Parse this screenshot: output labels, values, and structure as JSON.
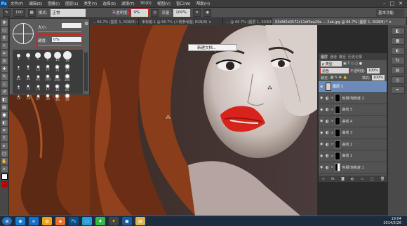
{
  "menu": {
    "app_icon": "Ps",
    "items": [
      "文件(F)",
      "编辑(E)",
      "图像(I)",
      "图层(L)",
      "类型(Y)",
      "选择(S)",
      "滤镜(T)",
      "3D(D)",
      "视图(V)",
      "窗口(W)",
      "帮助(H)"
    ],
    "window_controls": [
      "–",
      "□",
      "✕"
    ]
  },
  "options": {
    "brush_size": "100",
    "mode_label": "模式:",
    "mode_value": "正常",
    "opacity_label": "不透明度:",
    "opacity_value": "9%",
    "flow_label": "流量:",
    "flow_value": "100%",
    "workspace": "基本功能"
  },
  "tabs": [
    {
      "label": "... 66.7% (图层 1, RGB/8) ×",
      "active": false
    },
    {
      "label": "未标题-1 @ 66.7% (人物参考图, RGB/8) ×",
      "active": false
    },
    {
      "label": "... @ 66.7% (图层 1, RGB/8) ×",
      "active": false
    },
    {
      "label": "93d9f2d3572c11df3ea29e ... 2ab.jpg @ 66.7% (图层 1, RGB/8) * ×",
      "active": true
    }
  ],
  "brush_panel": {
    "size_label": "大小:",
    "hardness_label": "硬度:",
    "hardness_value": "0%",
    "presets": [
      {
        "size": "1"
      },
      {
        "size": "3"
      },
      {
        "size": "5"
      },
      {
        "size": "9"
      },
      {
        "size": "13"
      },
      {
        "size": "19"
      },
      {
        "size": ""
      },
      {
        "size": "5"
      },
      {
        "size": "9"
      },
      {
        "size": "13"
      },
      {
        "size": "17"
      },
      {
        "size": "21"
      },
      {
        "size": "27"
      },
      {
        "size": ""
      },
      {
        "size": "35"
      },
      {
        "size": "45"
      },
      {
        "size": "65"
      },
      {
        "size": "100"
      },
      {
        "size": "200"
      },
      {
        "size": "300"
      },
      {
        "size": ""
      },
      {
        "size": "9"
      },
      {
        "size": "13"
      },
      {
        "size": "19"
      },
      {
        "size": "17"
      },
      {
        "size": "45"
      },
      {
        "size": "65"
      },
      {
        "size": ""
      },
      {
        "size": "14"
      },
      {
        "size": "24"
      },
      {
        "size": "27"
      },
      {
        "size": "39"
      },
      {
        "size": "46"
      },
      {
        "size": "59"
      },
      {
        "size": ""
      }
    ]
  },
  "context_menu": {
    "item": "新建文档..."
  },
  "layers_panel": {
    "tabs": [
      "图层",
      "通道",
      "路径",
      "历史记录"
    ],
    "filter_label": "ρ 类型",
    "blend_mode": "滤色",
    "opacity_label": "不透明度:",
    "opacity_value": "100%",
    "lock_label": "锁定:",
    "fill_label": "填充:",
    "fill_value": "100%",
    "layers": [
      {
        "name": "图层 1",
        "active": true,
        "kind": "pixel"
      },
      {
        "name": "色相/饱和度 2",
        "active": false,
        "kind": "adj"
      },
      {
        "name": "曲线 5",
        "active": false,
        "kind": "adj"
      },
      {
        "name": "曲线 4",
        "active": false,
        "kind": "adj"
      },
      {
        "name": "曲线 3",
        "active": false,
        "kind": "adj"
      },
      {
        "name": "曲线 2",
        "active": false,
        "kind": "adj"
      },
      {
        "name": "曲线 1",
        "active": false,
        "kind": "adj"
      },
      {
        "name": "色相/饱和度 1",
        "active": false,
        "kind": "adj"
      }
    ],
    "footer_icons": [
      "link-icon",
      "fx-icon",
      "mask-icon",
      "adjustment-icon",
      "group-icon",
      "new-layer-icon",
      "trash-icon"
    ]
  },
  "taskbar": {
    "time": "19:04",
    "date": "2014/2/26",
    "apps": [
      "start-icon",
      "app-icon",
      "app-icon",
      "app-icon",
      "app-icon",
      "photoshop-icon",
      "app-icon",
      "app-icon",
      "app-icon",
      "app-icon",
      "app-icon"
    ]
  },
  "colors": {
    "lip": "#d8231c",
    "hair": "#7a3416",
    "skin": "#d9d0cb",
    "selection": "#6d8bb8",
    "highlight_box": "#d02020"
  }
}
